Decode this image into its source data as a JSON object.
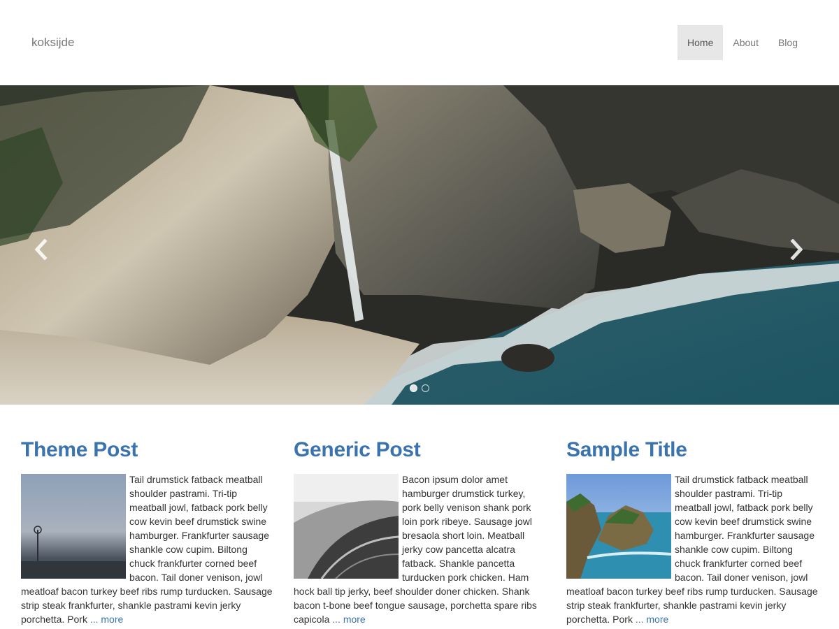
{
  "header": {
    "brand": "koksijde",
    "nav": [
      {
        "label": "Home",
        "active": true
      },
      {
        "label": "About",
        "active": false
      },
      {
        "label": "Blog",
        "active": false
      }
    ]
  },
  "carousel": {
    "slide_count": 2,
    "active_slide": 1,
    "controls": {
      "prev_icon": "chevron-left-icon",
      "next_icon": "chevron-right-icon"
    }
  },
  "posts": [
    {
      "title": "Theme Post",
      "text": "Tail drumstick fatback meatball shoulder pastrami. Tri-tip meatball jowl, fatback pork belly cow kevin beef drumstick swine hamburger. Frankfurter sausage shankle cow cupim. Biltong chuck frankfurter corned beef bacon. Tail doner venison, jowl meatloaf bacon turkey beef ribs rump turducken. Sausage strip steak frankfurter, shankle pastrami kevin jerky porchetta. Pork",
      "more": "... more"
    },
    {
      "title": "Generic Post",
      "text": "Bacon ipsum dolor amet hamburger drumstick turkey, pork belly venison shank pork loin pork ribeye. Sausage jowl bresaola short loin. Meatball jerky cow pancetta alcatra fatback. Shankle pancetta turducken pork chicken. Ham hock ball tip jerky, beef shoulder doner chicken. Shank bacon t-bone beef tongue sausage, porchetta spare ribs capicola",
      "more": "... more"
    },
    {
      "title": "Sample Title",
      "text": "Tail drumstick fatback meatball shoulder pastrami. Tri-tip meatball jowl, fatback pork belly cow kevin beef drumstick swine hamburger. Frankfurter sausage shankle cow cupim. Biltong chuck frankfurter corned beef bacon. Tail doner venison, jowl meatloaf bacon turkey beef ribs rump turducken. Sausage strip steak frankfurter, shankle pastrami kevin jerky porchetta. Pork",
      "more": "... more"
    }
  ],
  "colors": {
    "link": "#3a73ae",
    "nav_active_bg": "#e7e7e7",
    "text": "#333333"
  }
}
